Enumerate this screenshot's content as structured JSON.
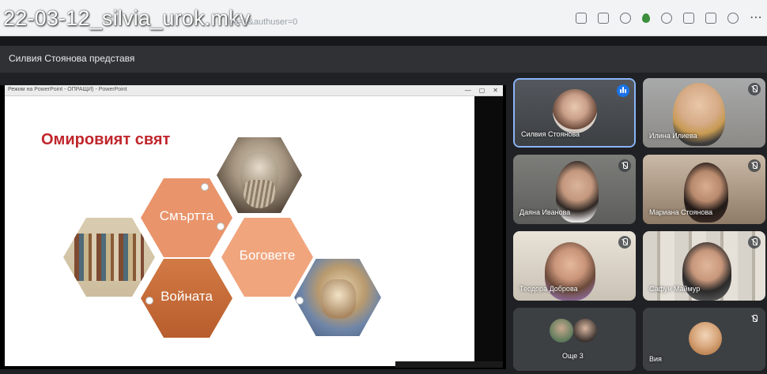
{
  "browser": {
    "file_title": "22-03-12_silvia_urok.mkv",
    "url_fragment": "pli=1&authuser=0"
  },
  "meet": {
    "presenting_text": "Силвия Стоянова представя"
  },
  "ppt": {
    "window_title": "Режим на PowerPoint - ОПРАЩИ) - PowerPoint"
  },
  "slide": {
    "title": "Омировият свят",
    "hexagons": [
      "Смъртта",
      "Боговете",
      "Войната"
    ]
  },
  "participants": [
    {
      "name": "Силвия Стоянова",
      "speaking": true
    },
    {
      "name": "Илина Илиева",
      "muted": true
    },
    {
      "name": "Даяна Иванова",
      "muted": true
    },
    {
      "name": "Мариана Стоянова",
      "muted": true
    },
    {
      "name": "Теодора Доброва",
      "muted": true
    },
    {
      "name": "Сафун Маймур",
      "muted": true
    },
    {
      "name": "Още 3"
    },
    {
      "name": "Вия",
      "muted": true
    }
  ],
  "colors": {
    "accent_blue": "#8ab4f8",
    "title_red": "#c0262c",
    "hex_orange": "#e8946b",
    "hex_dark_orange": "#c86a3a"
  }
}
